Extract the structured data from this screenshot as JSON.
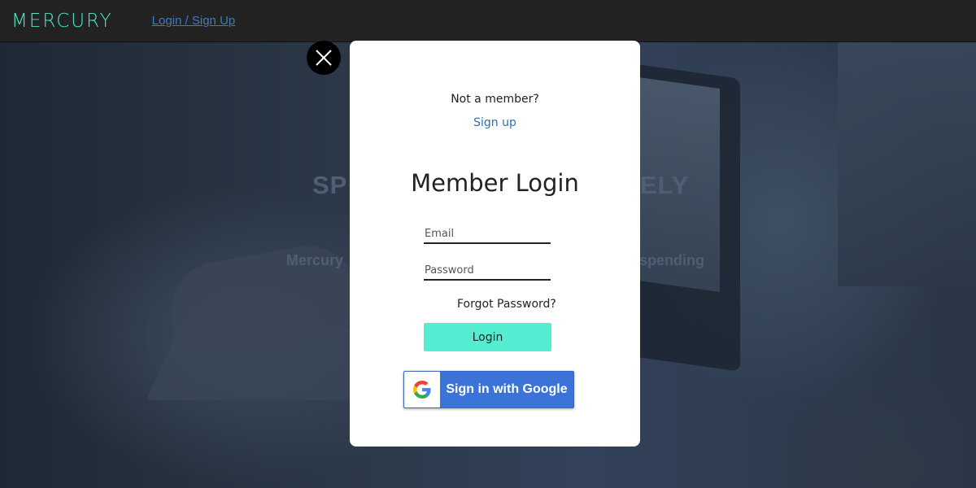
{
  "navbar": {
    "logo_text": "MERCURY",
    "login_link": "Login / Sign Up"
  },
  "hero": {
    "title_left": "SP",
    "title_right": "ELY",
    "subtitle_left": "Mercury",
    "subtitle_right": "spending"
  },
  "modal": {
    "not_member_text": "Not a member?",
    "signup_link": "Sign up",
    "title": "Member Login",
    "email_placeholder": "Email",
    "password_placeholder": "Password",
    "forgot_password": "Forgot Password?",
    "login_button": "Login",
    "google_button": "Sign in with Google"
  },
  "colors": {
    "brand_accent": "#4de8c8",
    "login_button": "#55edd2",
    "google_blue": "#3b73d9",
    "link_blue": "#2f6fad"
  },
  "icons": {
    "close": "close-icon",
    "google": "google-icon"
  }
}
